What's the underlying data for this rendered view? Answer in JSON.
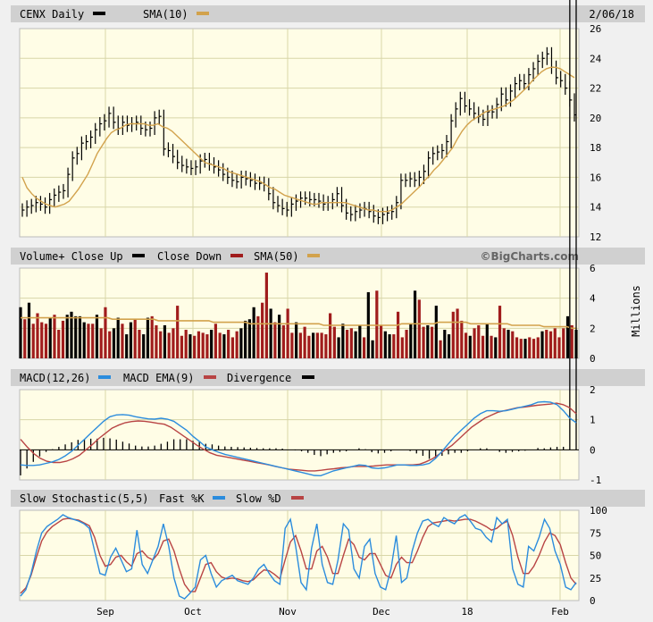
{
  "colors": {
    "background": "#f0f0f0",
    "plot_bg": "#fffde6",
    "header_bg": "#d0d0d0",
    "grid": "#d8d6a8",
    "price_bar": "#000000",
    "sma": "#d2a24c",
    "volume_up": "#000000",
    "volume_down": "#a01c1c",
    "macd": "#2b8cdd",
    "macd_ema": "#b84444",
    "divergence": "#000000",
    "fast_k": "#2b8cdd",
    "slow_d": "#b84444"
  },
  "header": {
    "symbol": "CENX Daily",
    "sma_label": "SMA(10)",
    "date": "2/06/18"
  },
  "volume_header": {
    "volume_label": "Volume+ Close Up",
    "close_down_label": "Close Down",
    "sma_label": "SMA(50)",
    "brand": "©BigCharts.com"
  },
  "macd_header": {
    "macd_label": "MACD(12,26)",
    "ema_label": "MACD EMA(9)",
    "divergence_label": "Divergence"
  },
  "stoch_header": {
    "slow_label": "Slow Stochastic(5,5)",
    "fast_label": "Fast %K",
    "slowd_label": "Slow %D"
  },
  "x_axis": {
    "labels": [
      "Sep",
      "Oct",
      "Nov",
      "Dec",
      "18",
      "Feb"
    ]
  },
  "chart_data": [
    {
      "type": "ohlc",
      "name": "price",
      "y_ticks": [
        "26",
        "24",
        "22",
        "20",
        "18",
        "16",
        "14",
        "12"
      ],
      "ylim": [
        12,
        26
      ],
      "close": [
        13.8,
        14.0,
        14.1,
        14.3,
        14.2,
        14.0,
        14.5,
        14.8,
        15.0,
        15.1,
        16.2,
        17.3,
        17.6,
        18.3,
        18.4,
        18.7,
        19.2,
        19.6,
        19.8,
        20.3,
        19.7,
        19.3,
        19.7,
        19.5,
        19.6,
        19.7,
        19.3,
        19.2,
        19.3,
        20.0,
        20.1,
        17.9,
        17.8,
        17.4,
        17.0,
        16.8,
        16.7,
        16.6,
        16.7,
        17.1,
        17.2,
        16.9,
        16.7,
        16.5,
        16.2,
        16.0,
        15.8,
        15.7,
        16.0,
        15.9,
        15.8,
        15.6,
        15.6,
        15.5,
        14.9,
        14.3,
        14.1,
        13.9,
        13.8,
        14.2,
        14.4,
        14.6,
        14.6,
        14.5,
        14.5,
        14.4,
        14.2,
        14.3,
        14.5,
        14.9,
        14.1,
        13.6,
        13.5,
        13.7,
        13.8,
        13.9,
        13.7,
        13.4,
        13.3,
        13.5,
        13.6,
        13.7,
        14.3,
        15.8,
        15.8,
        15.9,
        15.8,
        16.0,
        16.4,
        17.3,
        17.6,
        17.7,
        17.8,
        18.4,
        19.8,
        20.6,
        21.3,
        20.8,
        20.6,
        20.3,
        20.1,
        19.9,
        20.4,
        20.4,
        20.9,
        21.6,
        21.2,
        21.8,
        22.3,
        22.5,
        22.3,
        22.9,
        23.3,
        23.8,
        24.0,
        24.3,
        23.4,
        22.7,
        22.5,
        22.0,
        21.2,
        20.2
      ],
      "sma10": [
        16.0,
        15.3,
        14.9,
        14.6,
        14.4,
        14.2,
        14.1,
        14.0,
        14.1,
        14.2,
        14.4,
        14.8,
        15.2,
        15.7,
        16.2,
        16.9,
        17.6,
        18.1,
        18.6,
        19.0,
        19.2,
        19.3,
        19.5,
        19.6,
        19.6,
        19.6,
        19.6,
        19.5,
        19.5,
        19.6,
        19.4,
        19.3,
        19.1,
        18.8,
        18.5,
        18.2,
        17.9,
        17.6,
        17.3,
        17.0,
        16.9,
        16.8,
        16.7,
        16.6,
        16.4,
        16.3,
        16.2,
        16.1,
        16.0,
        15.9,
        15.8,
        15.7,
        15.5,
        15.3,
        15.2,
        15.0,
        14.8,
        14.7,
        14.6,
        14.5,
        14.4,
        14.3,
        14.2,
        14.2,
        14.3,
        14.3,
        14.3,
        14.3,
        14.3,
        14.3,
        14.2,
        14.1,
        14.0,
        13.9,
        13.8,
        13.8,
        13.7,
        13.7,
        13.7,
        13.8,
        14.0,
        14.2,
        14.5,
        14.8,
        15.1,
        15.4,
        15.8,
        16.1,
        16.5,
        16.8,
        17.2,
        17.6,
        18.0,
        18.6,
        19.1,
        19.5,
        19.8,
        20.0,
        20.2,
        20.4,
        20.5,
        20.6,
        20.7,
        20.8,
        21.0,
        21.2,
        21.5,
        21.8,
        22.1,
        22.5,
        22.8,
        23.1,
        23.3,
        23.4,
        23.4,
        23.3,
        23.1,
        22.9,
        22.7
      ]
    },
    {
      "type": "bar",
      "name": "volume",
      "y_ticks": [
        "6",
        "4",
        "2",
        "0"
      ],
      "ylabel": "Millions",
      "ylim": [
        0,
        6
      ],
      "values": [
        3.4,
        2.6,
        3.7,
        2.3,
        3.0,
        2.4,
        2.3,
        2.7,
        2.9,
        1.9,
        2.5,
        2.9,
        3.1,
        2.8,
        2.8,
        2.4,
        2.3,
        2.3,
        2.9,
        2.0,
        3.4,
        1.8,
        2.0,
        2.7,
        2.3,
        1.6,
        2.4,
        2.6,
        1.9,
        1.6,
        2.7,
        2.8,
        2.2,
        1.8,
        2.2,
        1.7,
        2.0,
        3.5,
        1.5,
        1.9,
        1.6,
        1.5,
        1.8,
        1.7,
        1.6,
        1.9,
        2.3,
        1.7,
        1.6,
        1.9,
        1.4,
        1.8,
        2.0,
        2.5,
        2.6,
        3.4,
        2.8,
        3.7,
        5.7,
        3.3,
        2.4,
        2.9,
        2.2,
        3.3,
        1.7,
        2.4,
        1.7,
        2.1,
        1.5,
        1.7,
        1.7,
        1.7,
        1.6,
        3.0,
        2.1,
        1.4,
        2.3,
        1.9,
        2.0,
        1.8,
        2.2,
        1.4,
        4.4,
        1.2,
        4.5,
        2.2,
        1.8,
        1.6,
        1.6,
        3.1,
        1.4,
        1.9,
        2.3,
        4.5,
        3.9,
        2.1,
        2.2,
        2.1,
        3.5,
        1.2,
        1.9,
        1.6,
        3.1,
        3.3,
        2.5,
        1.7,
        1.5,
        2.0,
        2.2,
        1.5,
        2.3,
        1.5,
        1.4,
        3.5,
        2.0,
        1.9,
        1.8,
        1.4,
        1.3,
        1.3,
        1.4,
        1.3,
        1.4,
        1.8,
        1.9,
        1.8,
        2.0,
        1.4,
        2.0,
        2.8,
        2.2,
        1.9
      ],
      "direction": [
        "up",
        "down",
        "up",
        "down",
        "down",
        "down",
        "down",
        "up",
        "down",
        "down",
        "down",
        "up",
        "up",
        "up",
        "up",
        "up",
        "down",
        "down",
        "up",
        "down",
        "down",
        "down",
        "up",
        "up",
        "down",
        "up",
        "up",
        "down",
        "down",
        "up",
        "up",
        "down",
        "down",
        "down",
        "up",
        "down",
        "down",
        "down",
        "down",
        "down",
        "up",
        "down",
        "down",
        "down",
        "down",
        "up",
        "down",
        "down",
        "up",
        "down",
        "down",
        "down",
        "up",
        "up",
        "up",
        "up",
        "down",
        "down",
        "down",
        "up",
        "down",
        "up",
        "down",
        "down",
        "down",
        "up",
        "down",
        "down",
        "down",
        "up",
        "down",
        "down",
        "down",
        "down",
        "down",
        "up",
        "up",
        "down",
        "down",
        "up",
        "up",
        "down",
        "up",
        "up",
        "down",
        "down",
        "up",
        "up",
        "down",
        "down",
        "down",
        "down",
        "up",
        "up",
        "down",
        "down",
        "up",
        "down",
        "up",
        "down",
        "up",
        "up",
        "down",
        "down",
        "down",
        "down",
        "up",
        "down",
        "down",
        "down",
        "up",
        "down",
        "up",
        "down",
        "down",
        "up",
        "down",
        "down",
        "down",
        "up",
        "down",
        "down",
        "down",
        "up",
        "down",
        "down",
        "down",
        "down",
        "down",
        "up",
        "down",
        "up",
        "down"
      ],
      "sma50": [
        2.7,
        2.7,
        2.7,
        2.7,
        2.7,
        2.7,
        2.7,
        2.7,
        2.7,
        2.7,
        2.7,
        2.7,
        2.7,
        2.7,
        2.7,
        2.7,
        2.7,
        2.7,
        2.7,
        2.7,
        2.6,
        2.6,
        2.6,
        2.6,
        2.6,
        2.6,
        2.6,
        2.6,
        2.6,
        2.6,
        2.5,
        2.5,
        2.5,
        2.5,
        2.5,
        2.5,
        2.5,
        2.5,
        2.5,
        2.5,
        2.5,
        2.5,
        2.4,
        2.4,
        2.4,
        2.4,
        2.4,
        2.4,
        2.4,
        2.4,
        2.3,
        2.3,
        2.3,
        2.3,
        2.3,
        2.3,
        2.3,
        2.3,
        2.3,
        2.3,
        2.3,
        2.3,
        2.3,
        2.3,
        2.3,
        2.3,
        2.2,
        2.2,
        2.2,
        2.2,
        2.2,
        2.2,
        2.2,
        2.2,
        2.2,
        2.2,
        2.2,
        2.2,
        2.2,
        2.2,
        2.2,
        2.2,
        2.2,
        2.3,
        2.3,
        2.3,
        2.3,
        2.3,
        2.3,
        2.3,
        2.3,
        2.4,
        2.4,
        2.4,
        2.4,
        2.4,
        2.4,
        2.4,
        2.3,
        2.3,
        2.3,
        2.3,
        2.3,
        2.3,
        2.3,
        2.3,
        2.3,
        2.2,
        2.2,
        2.2,
        2.2,
        2.2,
        2.2,
        2.2,
        2.1,
        2.1,
        2.1,
        2.1,
        2.1,
        2.1,
        2.0,
        2.0
      ]
    },
    {
      "type": "line",
      "name": "macd",
      "y_ticks": [
        "2",
        "1",
        "0",
        "-1"
      ],
      "ylim": [
        -1,
        2
      ],
      "macd": [
        -0.5,
        -0.52,
        -0.52,
        -0.5,
        -0.45,
        -0.4,
        -0.32,
        -0.2,
        -0.05,
        0.15,
        0.35,
        0.55,
        0.75,
        0.95,
        1.1,
        1.16,
        1.17,
        1.15,
        1.1,
        1.06,
        1.03,
        1.02,
        1.05,
        1.02,
        0.95,
        0.8,
        0.65,
        0.45,
        0.28,
        0.1,
        0.0,
        -0.08,
        -0.15,
        -0.2,
        -0.25,
        -0.3,
        -0.35,
        -0.4,
        -0.45,
        -0.5,
        -0.55,
        -0.6,
        -0.65,
        -0.7,
        -0.75,
        -0.8,
        -0.85,
        -0.86,
        -0.78,
        -0.7,
        -0.65,
        -0.6,
        -0.55,
        -0.5,
        -0.52,
        -0.6,
        -0.62,
        -0.6,
        -0.55,
        -0.5,
        -0.5,
        -0.52,
        -0.52,
        -0.5,
        -0.45,
        -0.28,
        -0.05,
        0.2,
        0.45,
        0.65,
        0.85,
        1.05,
        1.2,
        1.3,
        1.3,
        1.28,
        1.3,
        1.35,
        1.4,
        1.45,
        1.5,
        1.58,
        1.6,
        1.58,
        1.5,
        1.3,
        1.05,
        0.9
      ],
      "ema": [
        0.35,
        0.1,
        -0.12,
        -0.28,
        -0.38,
        -0.42,
        -0.42,
        -0.38,
        -0.3,
        -0.18,
        0.0,
        0.18,
        0.38,
        0.55,
        0.72,
        0.82,
        0.9,
        0.94,
        0.96,
        0.95,
        0.92,
        0.88,
        0.85,
        0.75,
        0.6,
        0.45,
        0.3,
        0.15,
        0.02,
        -0.1,
        -0.18,
        -0.22,
        -0.26,
        -0.3,
        -0.34,
        -0.38,
        -0.42,
        -0.46,
        -0.5,
        -0.55,
        -0.6,
        -0.64,
        -0.66,
        -0.68,
        -0.7,
        -0.7,
        -0.68,
        -0.65,
        -0.63,
        -0.6,
        -0.58,
        -0.55,
        -0.55,
        -0.55,
        -0.54,
        -0.52,
        -0.5,
        -0.5,
        -0.5,
        -0.5,
        -0.5,
        -0.48,
        -0.4,
        -0.3,
        -0.15,
        0.0,
        0.15,
        0.35,
        0.55,
        0.75,
        0.9,
        1.05,
        1.15,
        1.25,
        1.3,
        1.35,
        1.4,
        1.42,
        1.45,
        1.48,
        1.5,
        1.52,
        1.55,
        1.5,
        1.4,
        1.2
      ]
    },
    {
      "type": "line",
      "name": "slow_stochastic",
      "y_ticks": [
        "100",
        "75",
        "50",
        "25",
        "0"
      ],
      "ylim": [
        0,
        100
      ],
      "fast_k": [
        5,
        12,
        30,
        55,
        75,
        82,
        86,
        90,
        95,
        92,
        90,
        88,
        85,
        80,
        55,
        30,
        28,
        48,
        58,
        45,
        32,
        35,
        78,
        40,
        30,
        45,
        60,
        85,
        60,
        25,
        5,
        2,
        8,
        15,
        45,
        50,
        30,
        15,
        22,
        25,
        28,
        22,
        20,
        18,
        25,
        35,
        40,
        30,
        22,
        18,
        80,
        90,
        60,
        20,
        12,
        58,
        85,
        40,
        20,
        18,
        45,
        85,
        78,
        35,
        25,
        60,
        68,
        30,
        15,
        12,
        35,
        72,
        20,
        25,
        55,
        75,
        88,
        90,
        85,
        82,
        92,
        88,
        85,
        92,
        95,
        88,
        80,
        78,
        70,
        65,
        92,
        85,
        90,
        35,
        18,
        15,
        60,
        55,
        70,
        90,
        80,
        55,
        40,
        15,
        12,
        20
      ],
      "slow_d": [
        8,
        14,
        28,
        48,
        66,
        76,
        82,
        86,
        90,
        91,
        90,
        89,
        86,
        83,
        70,
        50,
        38,
        40,
        48,
        50,
        43,
        38,
        52,
        55,
        48,
        45,
        52,
        66,
        68,
        55,
        35,
        18,
        10,
        10,
        25,
        40,
        42,
        32,
        26,
        24,
        25,
        24,
        22,
        21,
        23,
        29,
        34,
        33,
        29,
        24,
        45,
        65,
        72,
        55,
        35,
        35,
        55,
        60,
        48,
        30,
        30,
        50,
        68,
        62,
        48,
        45,
        52,
        52,
        40,
        28,
        25,
        40,
        48,
        42,
        42,
        55,
        70,
        82,
        86,
        87,
        88,
        89,
        88,
        89,
        90,
        90,
        88,
        85,
        82,
        78,
        80,
        85,
        88,
        72,
        48,
        30,
        30,
        38,
        50,
        65,
        75,
        72,
        62,
        42,
        25,
        18
      ]
    }
  ]
}
